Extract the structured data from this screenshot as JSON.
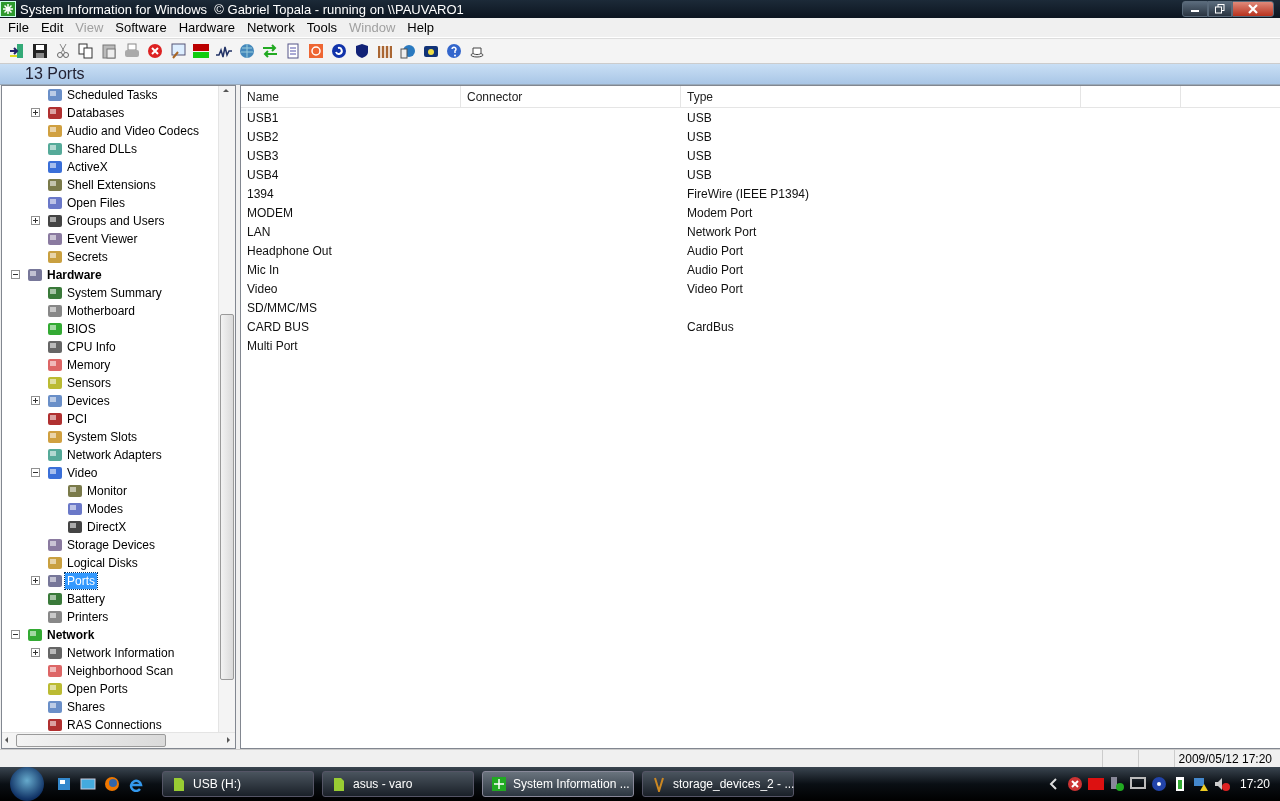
{
  "window": {
    "title": "System Information for Windows  © Gabriel Topala - running on \\\\PAUVARO1"
  },
  "menu": [
    {
      "label": "File",
      "disabled": false
    },
    {
      "label": "Edit",
      "disabled": false
    },
    {
      "label": "View",
      "disabled": true
    },
    {
      "label": "Software",
      "disabled": false
    },
    {
      "label": "Hardware",
      "disabled": false
    },
    {
      "label": "Network",
      "disabled": false
    },
    {
      "label": "Tools",
      "disabled": false
    },
    {
      "label": "Window",
      "disabled": true
    },
    {
      "label": "Help",
      "disabled": false
    }
  ],
  "header": "13 Ports",
  "tree": [
    {
      "children": [
        {
          "label": "Scheduled Tasks",
          "selected": false
        },
        {
          "label": "Databases",
          "selected": false,
          "expanded": false
        },
        {
          "label": "Audio and Video Codecs",
          "selected": false
        },
        {
          "label": "Shared DLLs",
          "selected": false
        },
        {
          "label": "ActiveX",
          "selected": false
        },
        {
          "label": "Shell Extensions",
          "selected": false
        },
        {
          "label": "Open Files",
          "selected": false
        },
        {
          "label": "Groups and Users",
          "selected": false,
          "expanded": false
        },
        {
          "label": "Event Viewer",
          "selected": false
        },
        {
          "label": "Secrets",
          "selected": false
        }
      ]
    },
    {
      "label": "Hardware",
      "selected": false,
      "expanded": true,
      "children": [
        {
          "label": "System Summary",
          "selected": false
        },
        {
          "label": "Motherboard",
          "selected": false
        },
        {
          "label": "BIOS",
          "selected": false
        },
        {
          "label": "CPU Info",
          "selected": false
        },
        {
          "label": "Memory",
          "selected": false
        },
        {
          "label": "Sensors",
          "selected": false
        },
        {
          "label": "Devices",
          "selected": false,
          "expanded": false
        },
        {
          "label": "PCI",
          "selected": false
        },
        {
          "label": "System Slots",
          "selected": false
        },
        {
          "label": "Network Adapters",
          "selected": false
        },
        {
          "label": "Video",
          "selected": false,
          "expanded": true,
          "children": [
            {
              "label": "Monitor",
              "selected": false
            },
            {
              "label": "Modes",
              "selected": false
            },
            {
              "label": "DirectX",
              "selected": false
            }
          ]
        },
        {
          "label": "Storage Devices",
          "selected": false
        },
        {
          "label": "Logical Disks",
          "selected": false
        },
        {
          "label": "Ports",
          "selected": true,
          "expanded": false
        },
        {
          "label": "Battery",
          "selected": false
        },
        {
          "label": "Printers",
          "selected": false
        }
      ]
    },
    {
      "label": "Network",
      "selected": false,
      "expanded": true,
      "children": [
        {
          "label": "Network Information",
          "selected": false,
          "expanded": false
        },
        {
          "label": "Neighborhood Scan",
          "selected": false
        },
        {
          "label": "Open Ports",
          "selected": false
        },
        {
          "label": "Shares",
          "selected": false
        },
        {
          "label": "RAS Connections",
          "selected": false
        }
      ]
    }
  ],
  "table": {
    "columns": [
      "Name",
      "Connector",
      "Type"
    ],
    "rows": [
      {
        "name": "USB1",
        "type": "USB"
      },
      {
        "name": "USB2",
        "type": "USB"
      },
      {
        "name": "USB3",
        "type": "USB"
      },
      {
        "name": "USB4",
        "type": "USB"
      },
      {
        "name": "1394",
        "type": "FireWire (IEEE P1394)"
      },
      {
        "name": "MODEM",
        "type": "Modem Port"
      },
      {
        "name": "LAN",
        "type": "Network Port"
      },
      {
        "name": "Headphone Out",
        "type": "Audio Port"
      },
      {
        "name": "Mic In",
        "type": "Audio Port"
      },
      {
        "name": "Video",
        "type": "Video Port"
      },
      {
        "name": "SD/MMC/MS"
      },
      {
        "name": "CARD BUS",
        "type": "CardBus"
      },
      {
        "name": "Multi Port"
      }
    ]
  },
  "status_bar": {
    "datetime": "2009/05/12 17:20"
  },
  "taskbar": {
    "tasks": [
      {
        "label": "USB (H:)",
        "selected": false
      },
      {
        "label": "asus - varo",
        "selected": false
      },
      {
        "label": "System Information ...",
        "selected": true
      },
      {
        "label": "storage_devices_2 - ...",
        "selected": false
      }
    ],
    "clock": "17:20"
  }
}
